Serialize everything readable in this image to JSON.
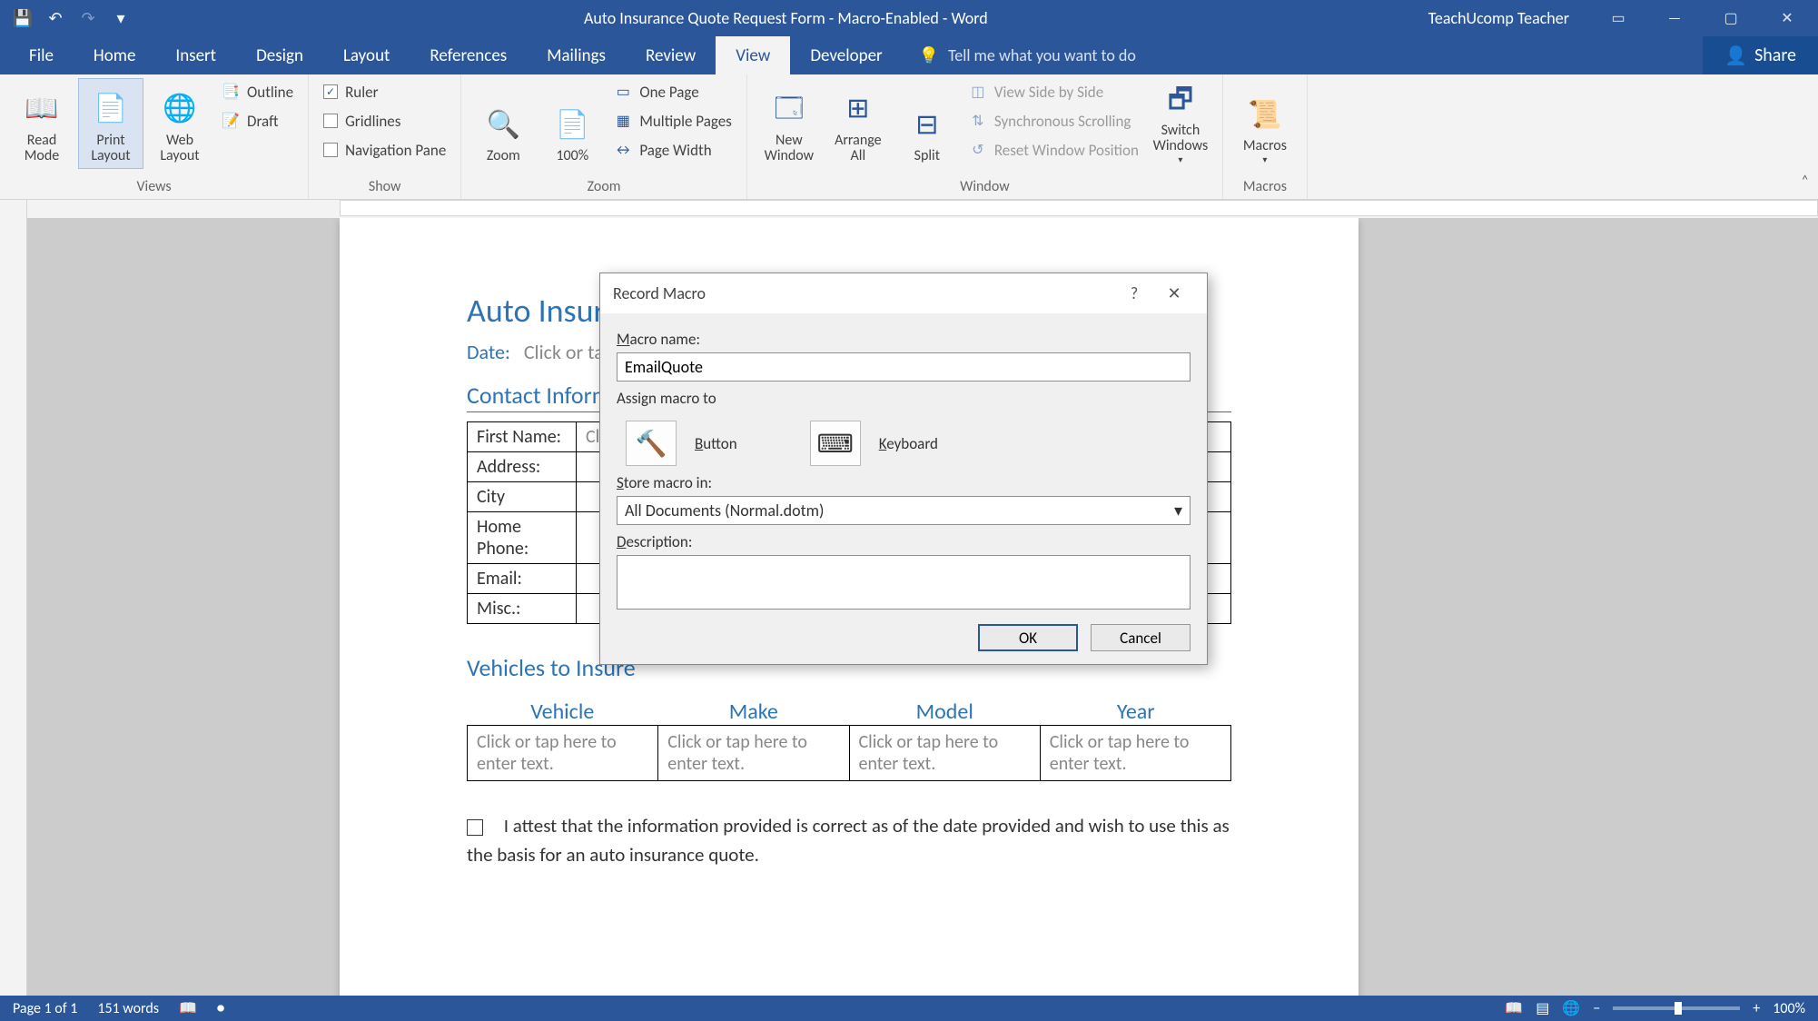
{
  "window": {
    "title": "Auto Insurance Quote Request Form - Macro-Enabled - Word",
    "user": "TeachUcomp Teacher"
  },
  "qat": {
    "save": "💾",
    "undo": "↶",
    "redo": "↷",
    "more": "▾"
  },
  "tabs": [
    "File",
    "Home",
    "Insert",
    "Design",
    "Layout",
    "References",
    "Mailings",
    "Review",
    "View",
    "Developer"
  ],
  "active_tab": "View",
  "tellme": "Tell me what you want to do",
  "share": "Share",
  "ribbon": {
    "views": {
      "label": "Views",
      "read_mode": "Read Mode",
      "print_layout": "Print Layout",
      "web_layout": "Web Layout",
      "outline": "Outline",
      "draft": "Draft"
    },
    "show": {
      "label": "Show",
      "ruler": "Ruler",
      "gridlines": "Gridlines",
      "nav": "Navigation Pane",
      "ruler_checked": true
    },
    "zoom": {
      "label": "Zoom",
      "zoom": "Zoom",
      "hundred": "100%",
      "one_page": "One Page",
      "multi": "Multiple Pages",
      "width": "Page Width"
    },
    "window": {
      "label": "Window",
      "new": "New Window",
      "arrange": "Arrange All",
      "split": "Split",
      "side": "View Side by Side",
      "sync": "Synchronous Scrolling",
      "reset": "Reset Window Position",
      "switch": "Switch Windows"
    },
    "macros": {
      "label": "Macros",
      "macros": "Macros"
    }
  },
  "doc": {
    "title": "Auto Insurance Quote Request Form",
    "date_label": "Date:",
    "date_val": "Click or tap to enter a date.",
    "contact_section": "Contact Information",
    "labels": {
      "first": "First Name:",
      "address": "Address:",
      "city": "City",
      "home": "Home Phone:",
      "email": "Email:",
      "misc": "Misc.:"
    },
    "placeholder": "Click or tap here to enter text.",
    "placeholder_wrap": "tap here to enter text.",
    "vehicles_section": "Vehicles to Insure",
    "veh_headers": [
      "Vehicle",
      "Make",
      "Model",
      "Year"
    ],
    "attest": "I attest that the information provided is correct as of the date provided and wish to use this as the basis for an auto insurance quote."
  },
  "dialog": {
    "title": "Record Macro",
    "name_label": "Macro name:",
    "name_value": "EmailQuote",
    "assign_label": "Assign macro to",
    "button": "Button",
    "keyboard": "Keyboard",
    "store_label": "Store macro in:",
    "store_value": "All Documents (Normal.dotm)",
    "desc_label": "Description:",
    "ok": "OK",
    "cancel": "Cancel"
  },
  "status": {
    "page": "Page 1 of 1",
    "words": "151 words",
    "zoom": "100%"
  }
}
